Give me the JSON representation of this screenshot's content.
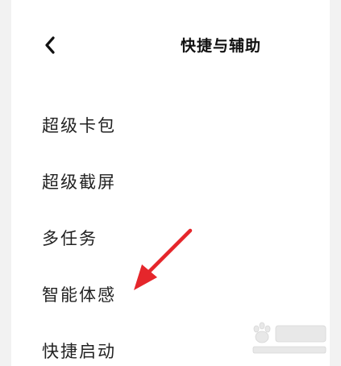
{
  "header": {
    "back_icon": "chevron-left-icon",
    "title": "快捷与辅助"
  },
  "menu": {
    "items": [
      {
        "label": "超级卡包"
      },
      {
        "label": "超级截屏"
      },
      {
        "label": "多任务"
      },
      {
        "label": "智能体感"
      },
      {
        "label": "快捷启动"
      }
    ]
  },
  "annotation": {
    "arrow_color": "#e5262b",
    "arrow_target": "智能体感"
  },
  "watermark": {
    "logo": "baidu-jingyan-watermark"
  }
}
